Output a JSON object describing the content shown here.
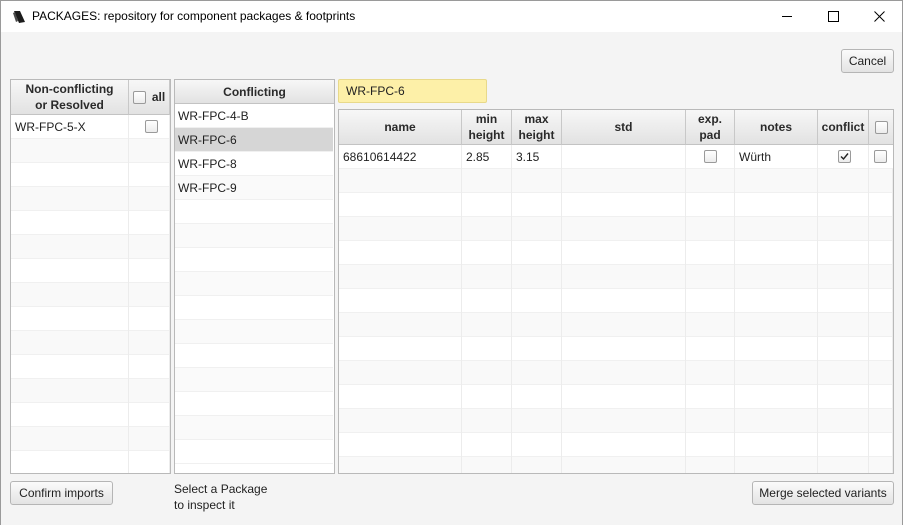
{
  "window": {
    "title": "PACKAGES: repository for component packages & footprints"
  },
  "buttons": {
    "cancel": "Cancel",
    "confirm_imports": "Confirm imports",
    "merge_variants": "Merge selected variants"
  },
  "left_table": {
    "header_name": "Non-conflicting\nor Resolved",
    "header_all": "all",
    "rows": [
      {
        "name": "WR-FPC-5-X",
        "checked": false
      }
    ]
  },
  "conflicting": {
    "header": "Conflicting",
    "items": [
      "WR-FPC-4-B",
      "WR-FPC-6",
      "WR-FPC-8",
      "WR-FPC-9"
    ],
    "selected_index": 1
  },
  "package_field": {
    "value": "WR-FPC-6"
  },
  "variants_table": {
    "columns": {
      "name": "name",
      "min_height": "min\nheight",
      "max_height": "max\nheight",
      "std": "std",
      "exp_pad": "exp.\npad",
      "notes": "notes",
      "conflict": "conflict"
    },
    "rows": [
      {
        "name": "68610614422",
        "min_height": "2.85",
        "max_height": "3.15",
        "std": "",
        "exp_pad": false,
        "notes": "Würth",
        "conflict": true,
        "selected": false
      }
    ]
  },
  "hint": {
    "line1": "Select a Package",
    "line2": "to inspect it"
  }
}
